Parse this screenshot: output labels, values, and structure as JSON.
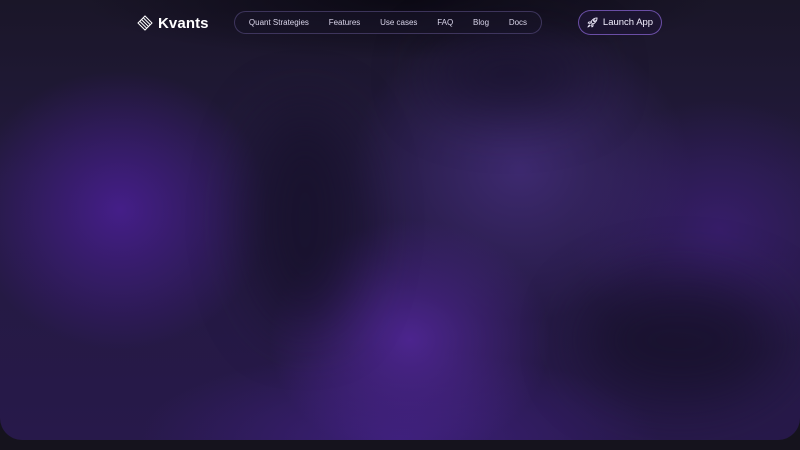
{
  "brand": {
    "name": "Kvants",
    "icon": "kvants-logo-icon"
  },
  "nav": {
    "items": [
      {
        "label": "Quant Strategies"
      },
      {
        "label": "Features"
      },
      {
        "label": "Use cases"
      },
      {
        "label": "FAQ"
      },
      {
        "label": "Blog"
      },
      {
        "label": "Docs"
      }
    ]
  },
  "cta": {
    "label": "Launch App",
    "icon": "rocket-icon"
  },
  "colors": {
    "background": "#15131d",
    "hero_glow": "#4a1f8c",
    "text": "#ffffff",
    "pill_border": "#6e5fa0",
    "cta_border": "#966ee6"
  }
}
